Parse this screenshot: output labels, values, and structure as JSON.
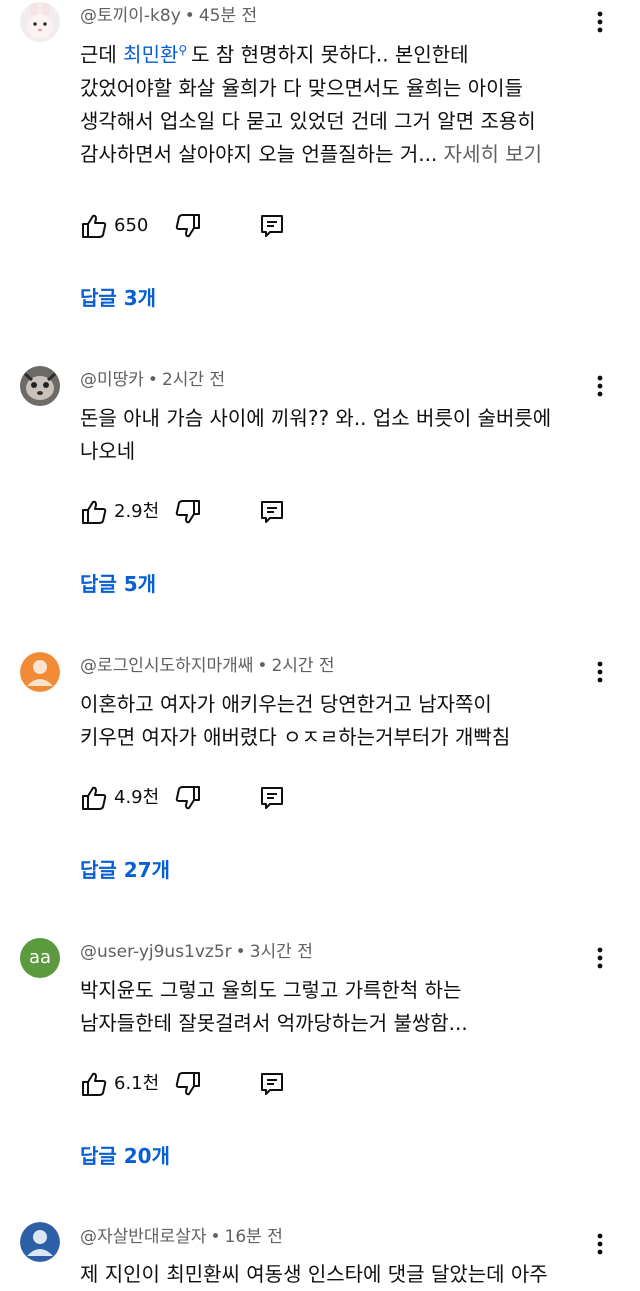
{
  "comments": [
    {
      "handle": "@토끼이-k8y",
      "time": "45분 전",
      "lines": [
        "도 참 현명하지 못하다.. 본인한테",
        "갔었어야할 화살 율희가 다 맞으면서도 율희는 아이들",
        "생각해서 업소일 다 묻고 있었던 건데 그거 알면 조용히",
        "감사하면서 살아야지 오늘 언플질하는 거..."
      ],
      "lead": "근데",
      "link": "최민환",
      "more": "자세히 보기",
      "likes": "650",
      "replies": "답글 3개"
    },
    {
      "handle": "@미땅카",
      "time": "2시간 전",
      "lines": [
        "돈을 아내 가슴 사이에 끼워?? 와.. 업소 버릇이 술버릇에",
        "나오네"
      ],
      "likes": "2.9천",
      "replies": "답글 5개"
    },
    {
      "handle": "@로그인시도하지마개쌔",
      "time": "2시간 전",
      "lines": [
        "이혼하고 여자가 애키우는건 당연한거고 남자쪽이",
        "키우면 여자가 애버렸다 ㅇㅈㄹ하는거부터가 개빡침"
      ],
      "likes": "4.9천",
      "replies": "답글 27개"
    },
    {
      "handle": "@user-yj9us1vz5r",
      "time": "3시간 전",
      "avatar_text": "aa",
      "lines": [
        "박지윤도 그렇고 율희도 그렇고 가륵한척 하는",
        "남자들한테 잘못걸려서 억까당하는거 불쌍함..."
      ],
      "likes": "6.1천",
      "replies": "답글 20개"
    },
    {
      "handle": "@자살반대로살자",
      "time": "16분 전",
      "lines": [
        "제 지인이 최민환씨 여동생 인스타에 댓글 달았는데 아주"
      ]
    }
  ],
  "colors": {
    "link": "#065fd4",
    "meta": "#606060",
    "avatar_orange": "#f08a35",
    "avatar_green": "#5c9a3f",
    "avatar_blue": "#2d5fa6"
  },
  "icons": {
    "like": "thumb-up-icon",
    "dislike": "thumb-down-icon",
    "reply": "comment-reply-icon",
    "menu": "more-vert-icon",
    "search": "search-icon"
  }
}
